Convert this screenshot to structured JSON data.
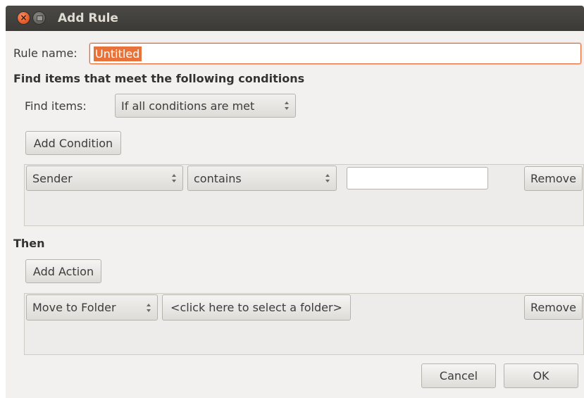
{
  "window": {
    "title": "Add Rule"
  },
  "rule": {
    "name_label": "Rule name:",
    "name_value": "Untitled"
  },
  "conditions": {
    "heading": "Find items that meet the following conditions",
    "find_items_label": "Find items:",
    "find_items_value": "If all conditions are met",
    "add_button": "Add Condition",
    "rows": [
      {
        "field": "Sender",
        "operator": "contains",
        "value": "",
        "remove_label": "Remove"
      }
    ]
  },
  "actions": {
    "heading": "Then",
    "add_button": "Add Action",
    "rows": [
      {
        "action": "Move to Folder",
        "folder_button": "<click here to select a folder>",
        "remove_label": "Remove"
      }
    ]
  },
  "footer": {
    "cancel_label": "Cancel",
    "ok_label": "OK"
  },
  "icons": [
    "close-icon",
    "minimize-icon",
    "combo-arrows-icon"
  ],
  "colors": {
    "titlebar": "#3b3a36",
    "close_button": "#e5521e",
    "selection": "#e8733a",
    "window_background": "#f2f1f0"
  }
}
